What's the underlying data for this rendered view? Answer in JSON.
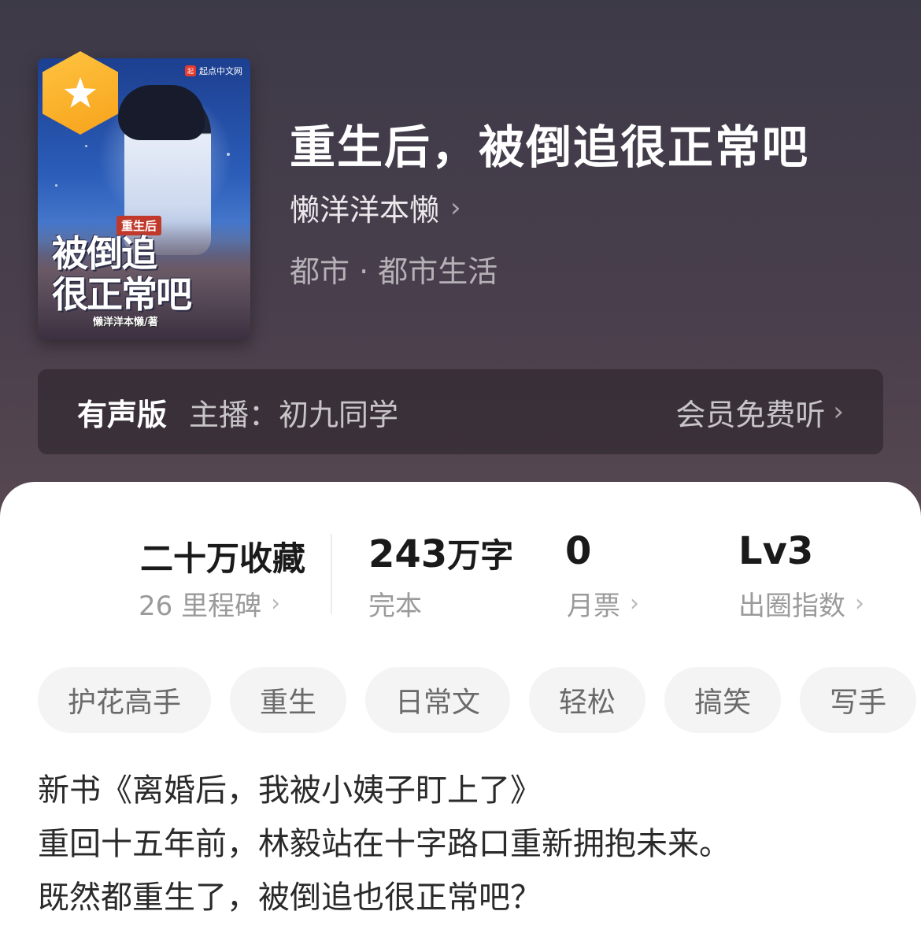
{
  "book": {
    "title": "重生后，被倒追很正常吧",
    "author": "懒洋洋本懒",
    "genre": "都市 · 都市生活"
  },
  "cover": {
    "publisher": "起点中文网",
    "publisher_mark": "起",
    "badge": "重生后",
    "title_line1": "被倒追",
    "title_line2": "很正常吧",
    "author_line": "懒洋洋本懒/著"
  },
  "audio": {
    "label": "有声版",
    "host": "主播：初九同学",
    "cta": "会员免费听"
  },
  "stats": {
    "collect_main": "二十万收藏",
    "collect_sub": "26 里程碑",
    "words_num": "243",
    "words_unit": "万字",
    "words_sub": "完本",
    "ticket_num": "0",
    "ticket_sub": "月票",
    "level": "Lv3",
    "level_sub": "出圈指数"
  },
  "tags": [
    "护花高手",
    "重生",
    "日常文",
    "轻松",
    "搞笑",
    "写手"
  ],
  "description": [
    "新书《离婚后，我被小姨子盯上了》",
    "重回十五年前，林毅站在十字路口重新拥抱未来。",
    "既然都重生了，被倒追也很正常吧？"
  ],
  "icons": {
    "chevron": "chevron-right-icon",
    "star": "star-icon"
  },
  "colors": {
    "accent": "#f7a21b",
    "header_bg": "#3d3a48"
  }
}
